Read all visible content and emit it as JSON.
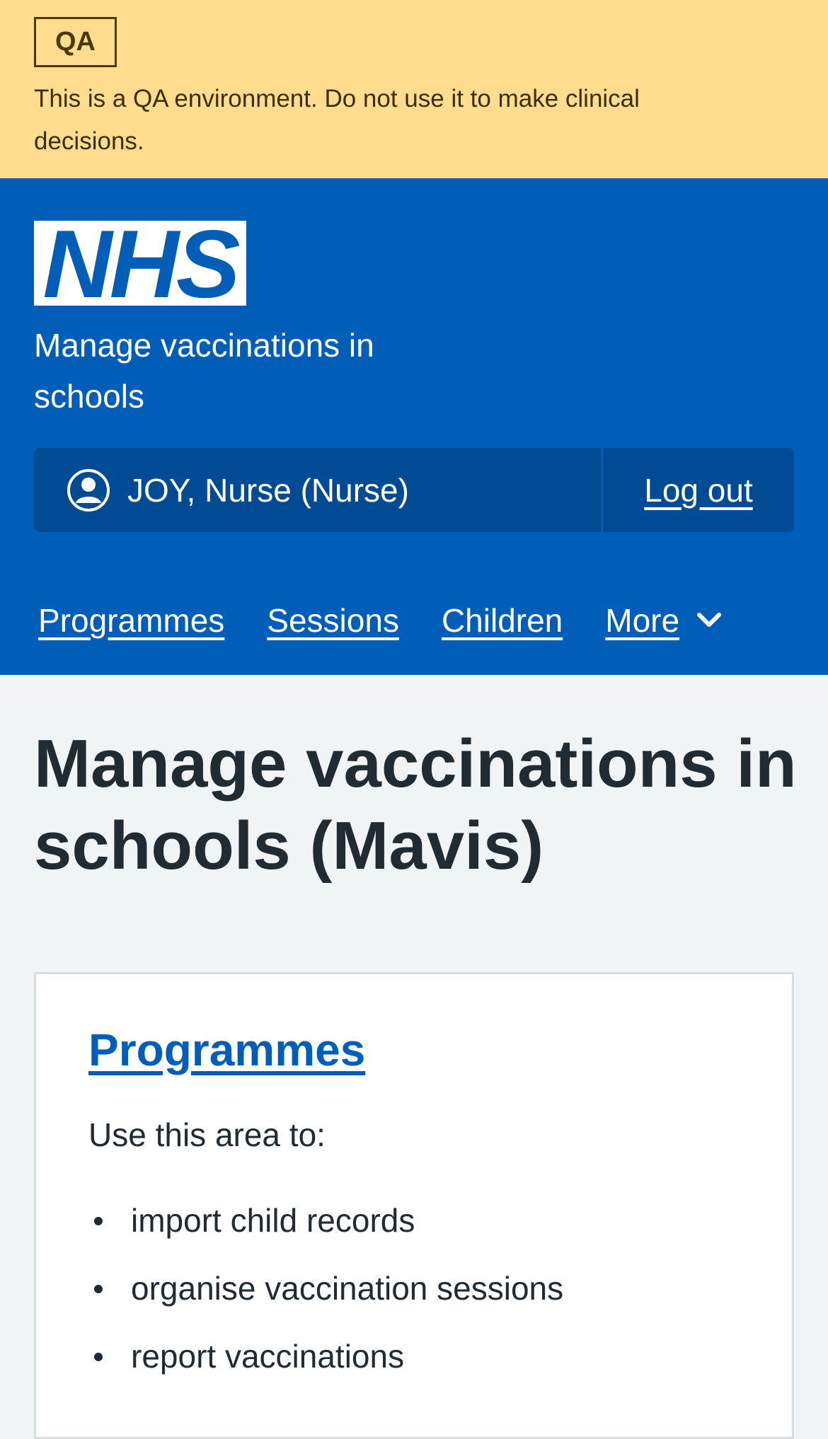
{
  "qa_banner": {
    "tag": "QA",
    "message": "This is a QA environment. Do not use it to make clinical decisions."
  },
  "header": {
    "logo_text": "NHS",
    "service_name": "Manage vaccinations in schools",
    "account": {
      "user": "JOY, Nurse (Nurse)",
      "logout_label": "Log out"
    },
    "nav": [
      {
        "label": "Programmes"
      },
      {
        "label": "Sessions"
      },
      {
        "label": "Children"
      },
      {
        "label": "More"
      }
    ]
  },
  "main": {
    "title": "Manage vaccinations in schools (Mavis)",
    "cards": [
      {
        "link": "Programmes",
        "intro": "Use this area to:",
        "items": [
          "import child records",
          "organise vaccination sessions",
          "report vaccinations"
        ]
      }
    ]
  },
  "colors": {
    "qa_banner": "#ffdc8e",
    "nhs_blue": "#005eb8",
    "account_bg": "#004b93",
    "page_bg": "#f0f4f5",
    "text": "#212b32"
  }
}
